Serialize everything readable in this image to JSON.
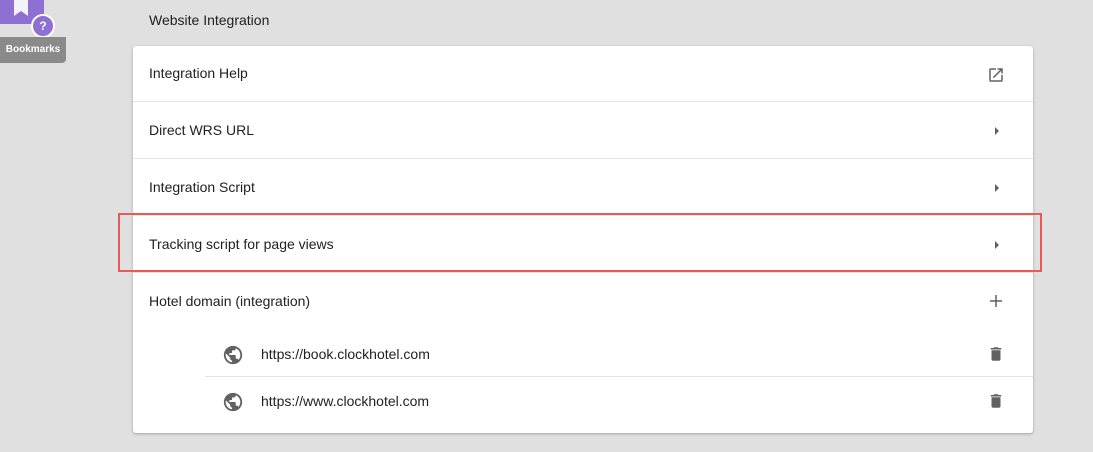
{
  "bookmarks": {
    "label": "Bookmarks",
    "help_symbol": "?",
    "accent": "#8e6fd3"
  },
  "section": {
    "title": "Website Integration"
  },
  "rows": [
    {
      "label": "Integration Help",
      "icon": "open-in-new-icon"
    },
    {
      "label": "Direct WRS URL",
      "icon": "arrow-right-icon"
    },
    {
      "label": "Integration Script",
      "icon": "arrow-right-icon"
    },
    {
      "label": "Tracking script for page views",
      "icon": "arrow-right-icon",
      "highlighted": true
    },
    {
      "label": "Hotel domain (integration)",
      "icon": "plus-icon"
    }
  ],
  "domains": [
    {
      "url": "https://book.clockhotel.com",
      "icon": "globe-icon",
      "action_icon": "trash-icon"
    },
    {
      "url": "https://www.clockhotel.com",
      "icon": "globe-icon",
      "action_icon": "trash-icon"
    }
  ],
  "colors": {
    "background": "#e0e0e0",
    "card": "#ffffff",
    "highlight_border": "#e85a5a",
    "icon": "#616161"
  }
}
